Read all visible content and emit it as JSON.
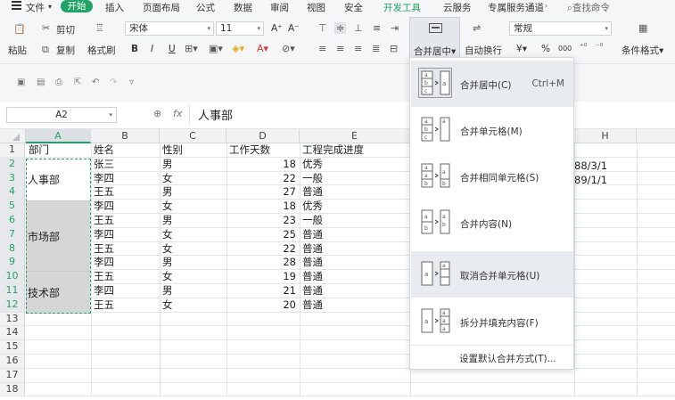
{
  "menubar": {
    "file": "文件",
    "start": "开始",
    "items": [
      "插入",
      "页面布局",
      "公式",
      "数据",
      "审阅",
      "视图",
      "安全",
      "开发工具",
      "云服务",
      "专属服务通道"
    ],
    "search": "查找命令"
  },
  "ribbon": {
    "paste": "粘贴",
    "cut": "剪切",
    "copy": "复制",
    "format_painter": "格式刷",
    "font_name": "宋体",
    "font_size": "11",
    "grow_font": "A⁺",
    "shrink_font": "A⁻",
    "bold": "B",
    "italic": "I",
    "underline": "U",
    "merge_center": "合并居中",
    "wrap_text": "自动换行",
    "number_format": "常规",
    "currency": "¥",
    "percent": "%",
    "thousands": "000",
    "cond_format": "条件格式"
  },
  "formula_bar": {
    "name_box": "A2",
    "fx": "fx",
    "value": "人事部"
  },
  "columns": [
    "A",
    "B",
    "C",
    "D",
    "E",
    "H"
  ],
  "rows": [
    "1",
    "2",
    "3",
    "4",
    "5",
    "6",
    "7",
    "8",
    "9",
    "10",
    "11",
    "12",
    "13",
    "14",
    "15",
    "16",
    "17",
    "18"
  ],
  "header_row": [
    "部门",
    "姓名",
    "性别",
    "工作天数",
    "工程完成进度"
  ],
  "data_rows": [
    {
      "name": "张三",
      "gender": "男",
      "days": "18",
      "progress": "优秀"
    },
    {
      "name": "李四",
      "gender": "女",
      "days": "22",
      "progress": "一般"
    },
    {
      "name": "王五",
      "gender": "男",
      "days": "27",
      "progress": "普通"
    },
    {
      "name": "李四",
      "gender": "女",
      "days": "18",
      "progress": "优秀"
    },
    {
      "name": "王五",
      "gender": "男",
      "days": "23",
      "progress": "一般"
    },
    {
      "name": "李四",
      "gender": "女",
      "days": "25",
      "progress": "普通"
    },
    {
      "name": "王五",
      "gender": "女",
      "days": "22",
      "progress": "普通"
    },
    {
      "name": "李四",
      "gender": "男",
      "days": "28",
      "progress": "普通"
    },
    {
      "name": "王五",
      "gender": "女",
      "days": "19",
      "progress": "普通"
    },
    {
      "name": "李四",
      "gender": "男",
      "days": "21",
      "progress": "普通"
    },
    {
      "name": "王五",
      "gender": "女",
      "days": "20",
      "progress": "普通"
    }
  ],
  "departments": [
    "人事部",
    "市场部",
    "技术部"
  ],
  "partial_dates": [
    "88/3/1",
    "89/1/1"
  ],
  "dropdown": {
    "items": [
      {
        "label": "合并居中(C)",
        "shortcut": "Ctrl+M"
      },
      {
        "label": "合并单元格(M)",
        "shortcut": ""
      },
      {
        "label": "合并相同单元格(S)",
        "shortcut": ""
      },
      {
        "label": "合并内容(N)",
        "shortcut": ""
      },
      {
        "label": "取消合并单元格(U)",
        "shortcut": ""
      },
      {
        "label": "拆分并填充内容(F)",
        "shortcut": ""
      }
    ],
    "footer": "设置默认合并方式(T)..."
  },
  "colors": {
    "accent": "#21a366",
    "merged_fill": "#d6d6d6"
  }
}
